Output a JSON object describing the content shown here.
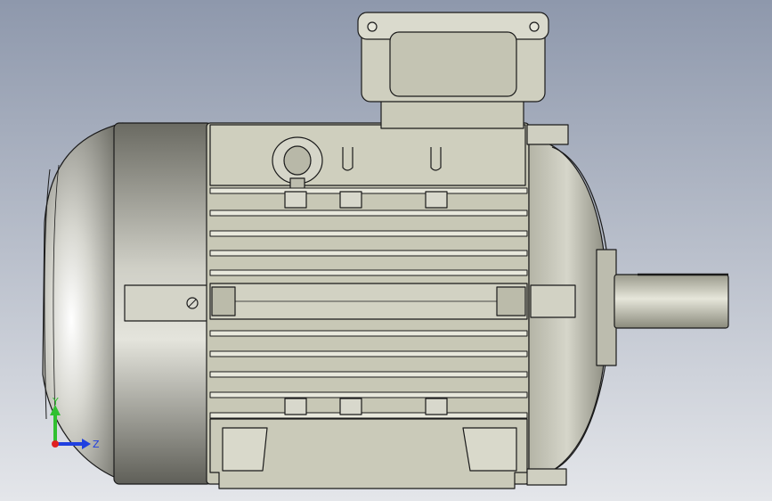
{
  "viewport": {
    "background_top": "#8e98ac",
    "background_bottom": "#e4e6ea"
  },
  "model": {
    "outline_color": "#1a1a1a",
    "body_color": "#c8c8b6",
    "fan_cover_color": "#b9b9a8",
    "shaft_color": "#cfcfc2"
  },
  "triad": {
    "y_label": "Y",
    "z_label": "Z",
    "y_color": "#30c030",
    "z_color": "#2040e0",
    "x_color": "#e02020"
  }
}
